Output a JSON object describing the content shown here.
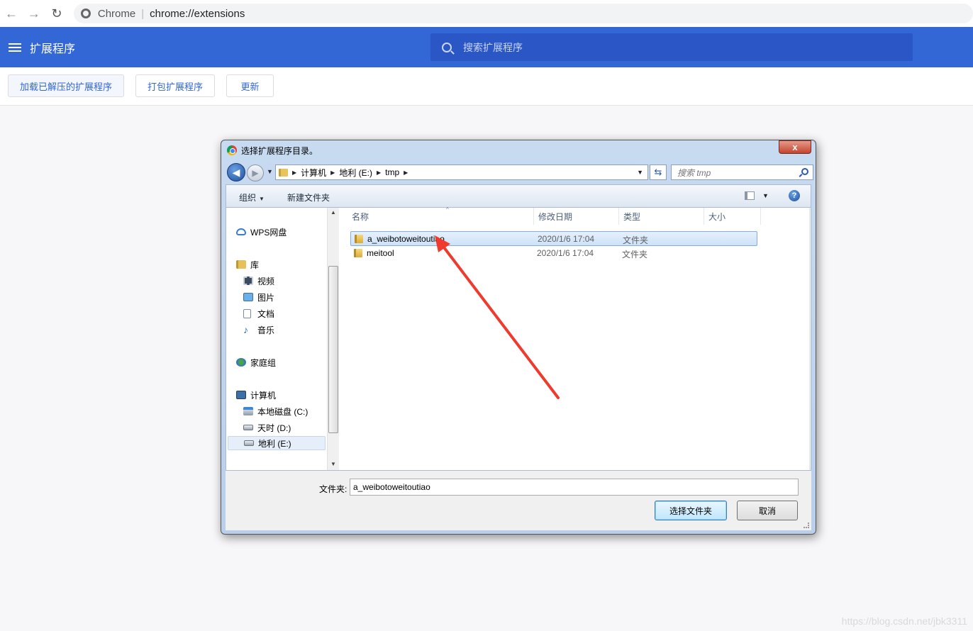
{
  "browser": {
    "site_label": "Chrome",
    "url": "chrome://extensions"
  },
  "extensions_page": {
    "title": "扩展程序",
    "search_placeholder": "搜索扩展程序",
    "toolbar": {
      "load_unpacked": "加载已解压的扩展程序",
      "pack_extension": "打包扩展程序",
      "update": "更新"
    }
  },
  "dialog": {
    "title": "选择扩展程序目录。",
    "close_label": "x",
    "breadcrumb": [
      "计算机",
      "地利 (E:)",
      "tmp"
    ],
    "search_placeholder": "搜索 tmp",
    "commands": {
      "organize": "组织",
      "new_folder": "新建文件夹"
    },
    "nav_pane": {
      "items": [
        {
          "label": "WPS网盘",
          "icon": "cloud-icon"
        },
        {
          "label": "库",
          "icon": "library-icon"
        },
        {
          "label": "视频",
          "icon": "video-icon"
        },
        {
          "label": "图片",
          "icon": "picture-icon"
        },
        {
          "label": "文档",
          "icon": "document-icon"
        },
        {
          "label": "音乐",
          "icon": "music-icon"
        },
        {
          "label": "家庭组",
          "icon": "homegroup-icon"
        },
        {
          "label": "计算机",
          "icon": "computer-icon"
        },
        {
          "label": "本地磁盘 (C:)",
          "icon": "drive-c-icon"
        },
        {
          "label": "天时 (D:)",
          "icon": "drive-icon"
        },
        {
          "label": "地利 (E:)",
          "icon": "drive-icon",
          "selected": true
        }
      ]
    },
    "columns": [
      "名称",
      "修改日期",
      "类型",
      "大小"
    ],
    "files": [
      {
        "name": "a_weibotoweitoutiao",
        "modified": "2020/1/6 17:04",
        "type": "文件夹",
        "selected": true
      },
      {
        "name": "meitool",
        "modified": "2020/1/6 17:04",
        "type": "文件夹"
      }
    ],
    "folder_label": "文件夹:",
    "folder_value": "a_weibotoweitoutiao",
    "select_button": "选择文件夹",
    "cancel_button": "取消"
  },
  "annotation_color": "#f03a2e",
  "watermark": "https://blog.csdn.net/jbk3311"
}
